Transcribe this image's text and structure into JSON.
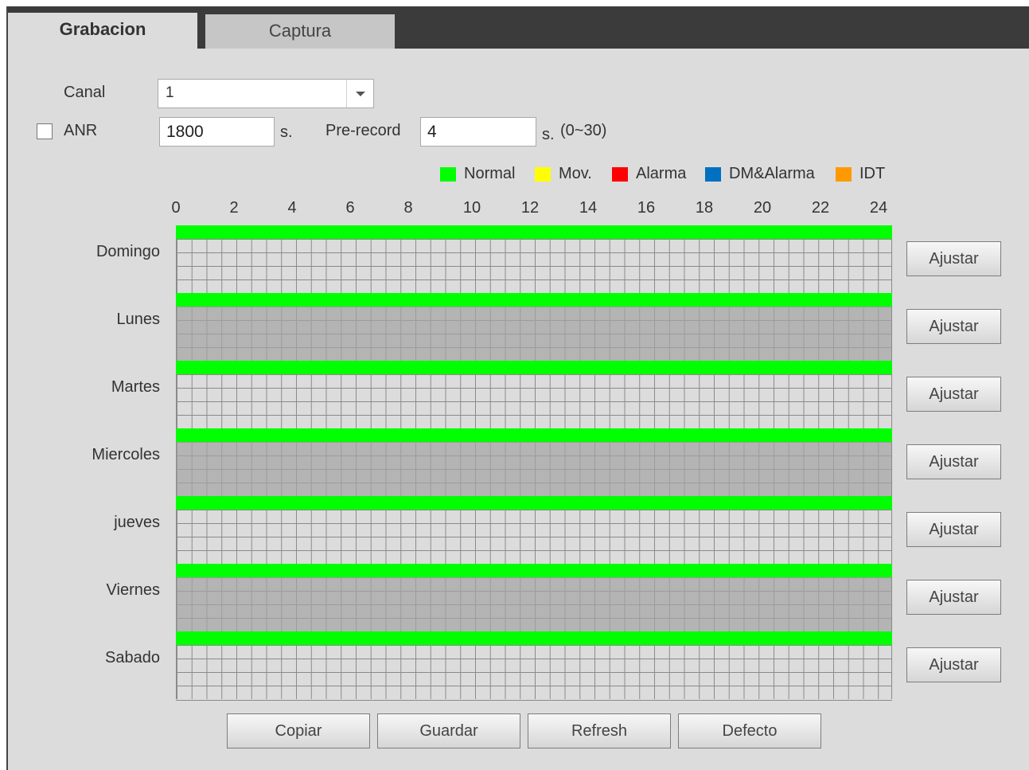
{
  "tabs": [
    {
      "label": "Grabacion",
      "active": true
    },
    {
      "label": "Captura",
      "active": false
    }
  ],
  "form": {
    "canal_label": "Canal",
    "canal_value": "1",
    "anr_label": "ANR",
    "anr_checked": false,
    "anr_value": "1800",
    "anr_unit": "s.",
    "prerecord_label": "Pre-record",
    "prerecord_value": "4",
    "prerecord_unit": "s.",
    "prerecord_range": "(0~30)"
  },
  "legend": [
    {
      "label": "Normal",
      "color": "#00ff00"
    },
    {
      "label": "Mov.",
      "color": "#ffff00"
    },
    {
      "label": "Alarma",
      "color": "#ff0000"
    },
    {
      "label": "DM&Alarma",
      "color": "#0070c0"
    },
    {
      "label": "IDT",
      "color": "#ff9900"
    }
  ],
  "hours": [
    "0",
    "2",
    "4",
    "6",
    "8",
    "10",
    "12",
    "14",
    "16",
    "18",
    "20",
    "22",
    "24"
  ],
  "days": [
    {
      "label": "Domingo",
      "schedule": "Normal 0-24",
      "adjust": "Ajustar"
    },
    {
      "label": "Lunes",
      "schedule": "Normal 0-24",
      "adjust": "Ajustar"
    },
    {
      "label": "Martes",
      "schedule": "Normal 0-24",
      "adjust": "Ajustar"
    },
    {
      "label": "Miercoles",
      "schedule": "Normal 0-24",
      "adjust": "Ajustar"
    },
    {
      "label": "jueves",
      "schedule": "Normal 0-24",
      "adjust": "Ajustar"
    },
    {
      "label": "Viernes",
      "schedule": "Normal 0-24",
      "adjust": "Ajustar"
    },
    {
      "label": "Sabado",
      "schedule": "Normal 0-24",
      "adjust": "Ajustar"
    }
  ],
  "buttons": {
    "copy": "Copiar",
    "save": "Guardar",
    "refresh": "Refresh",
    "default": "Defecto"
  }
}
